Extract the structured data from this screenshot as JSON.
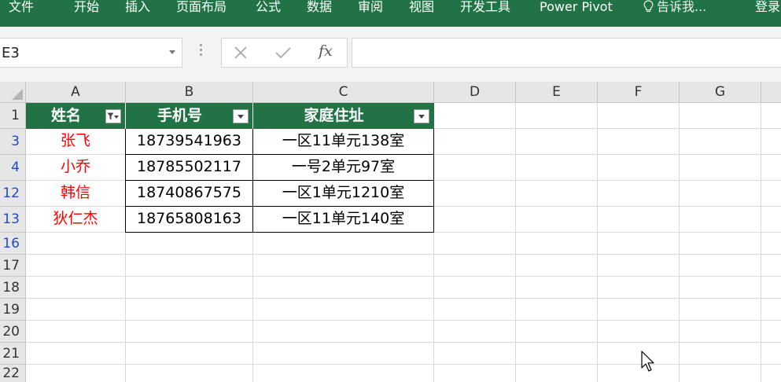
{
  "ribbon": {
    "tabs": [
      {
        "id": "file",
        "label": "文件"
      },
      {
        "id": "home",
        "label": "开始"
      },
      {
        "id": "insert",
        "label": "插入"
      },
      {
        "id": "page-layout",
        "label": "页面布局"
      },
      {
        "id": "formulas",
        "label": "公式"
      },
      {
        "id": "data",
        "label": "数据"
      },
      {
        "id": "review",
        "label": "审阅"
      },
      {
        "id": "view",
        "label": "视图"
      },
      {
        "id": "developer",
        "label": "开发工具"
      },
      {
        "id": "power-pivot",
        "label": "Power Pivot"
      }
    ],
    "tell_me": "告诉我...",
    "sign_in": "登录",
    "color": "#217346"
  },
  "formula_bar": {
    "name_box": "E3",
    "formula": "",
    "fx_label": "fx"
  },
  "columns": [
    "A",
    "B",
    "C",
    "D",
    "E",
    "F",
    "G"
  ],
  "rows": [
    "1",
    "3",
    "4",
    "12",
    "13",
    "16",
    "17",
    "18",
    "19",
    "20",
    "21",
    "22"
  ],
  "table": {
    "headers": [
      "姓名",
      "手机号",
      "家庭住址"
    ],
    "filtered_column": 0,
    "header_color": "#217346",
    "name_color": "#ff0000",
    "records": [
      {
        "name": "张飞",
        "phone": "18739541963",
        "address": "一区11单元138室"
      },
      {
        "name": "小乔",
        "phone": "18785502117",
        "address": "一号2单元97室"
      },
      {
        "name": "韩信",
        "phone": "18740867575",
        "address": "一区1单元1210室"
      },
      {
        "name": "狄仁杰",
        "phone": "18765808163",
        "address": "一区11单元140室"
      }
    ]
  },
  "filtered_row_color": "#1f4ac6"
}
